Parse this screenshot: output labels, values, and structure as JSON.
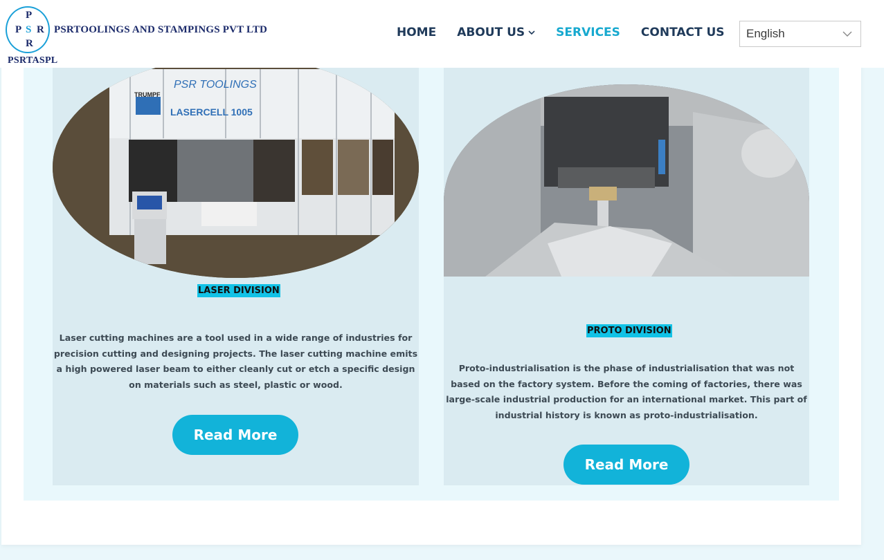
{
  "header": {
    "logo_letters": {
      "top": "P",
      "left": "P",
      "center": "S",
      "right": "R",
      "bottom": "R"
    },
    "brand_name": "PSRTOOLINGS AND STAMPINGS PVT LTD",
    "brand_short": "PSRTASPL"
  },
  "nav": {
    "items": [
      {
        "label": "HOME"
      },
      {
        "label": "ABOUT US"
      },
      {
        "label": "SERVICES"
      },
      {
        "label": "CONTACT US"
      }
    ],
    "active": "SERVICES"
  },
  "language": {
    "selected": "English"
  },
  "laser": {
    "image_text": {
      "line1": "PSR TOOLINGS",
      "line2": "LASERCELL 1005",
      "brand": "TRUMPF"
    },
    "title": "LASER DIVISION",
    "description": "Laser cutting machines are a tool used in a wide range of industries for precision cutting and designing projects. The laser cutting machine emits a high powered laser beam to either cleanly cut or etch a specific design on materials such as steel, plastic or wood.",
    "button": "Read More"
  },
  "proto": {
    "title": "PROTO DIVISION",
    "description": "Proto-industrialisation is the phase of industrialisation that was not based on the factory system. Before the coming of factories, there was large-scale industrial production for an international market. This part of industrial history is known as proto-industrialisation.",
    "button": "Read More"
  },
  "colors": {
    "accent": "#12b3d9",
    "nav_text": "#1f3a5a",
    "column_bg": "#daebf1",
    "section_bg": "#e9f8fc"
  },
  "icons": [
    "chevron-down-icon",
    "select-chevron-icon"
  ]
}
